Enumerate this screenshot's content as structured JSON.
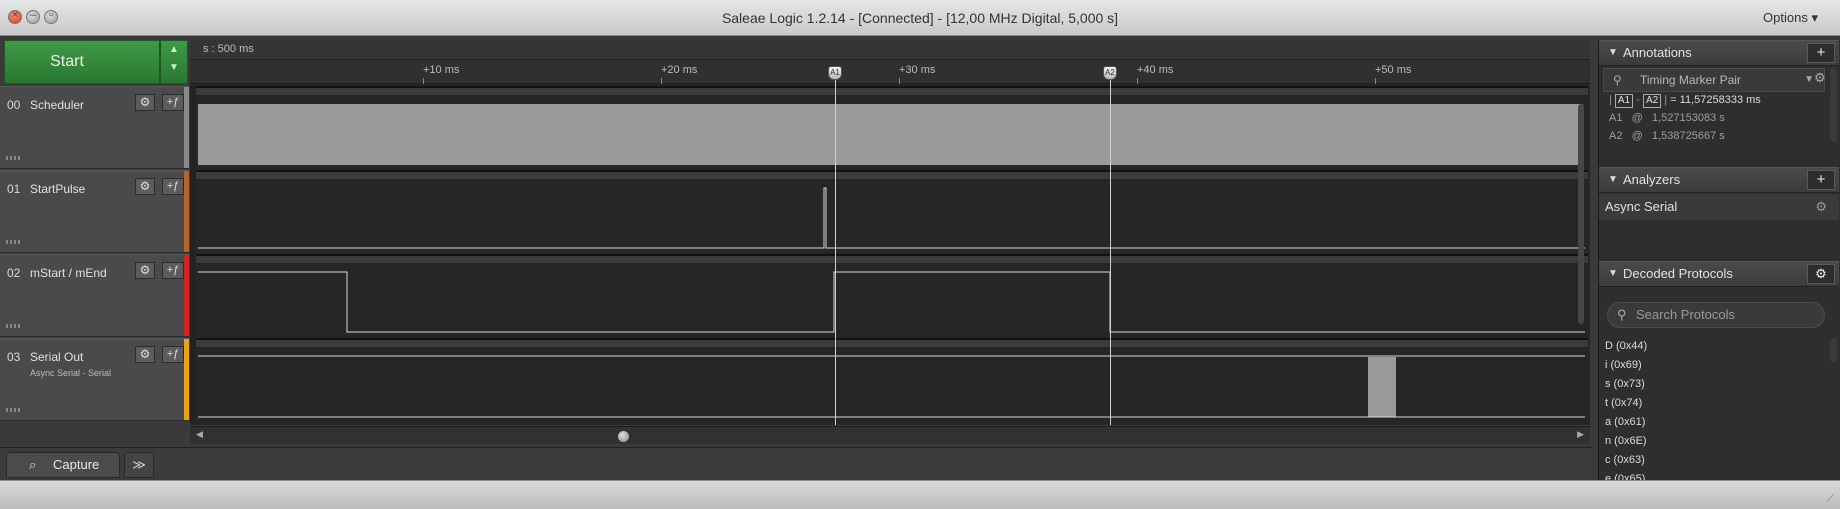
{
  "window": {
    "title": "Saleae Logic 1.2.14 - [Connected] - [12,00 MHz Digital, 5,000 s]",
    "options_label": "Options",
    "options_arrow": "▾"
  },
  "start_button": {
    "label": "Start"
  },
  "channels": [
    {
      "num": "00",
      "name": "Scheduler",
      "sub": "",
      "color": "#8a8a8a"
    },
    {
      "num": "01",
      "name": "StartPulse",
      "sub": "",
      "color": "#b5652b"
    },
    {
      "num": "02",
      "name": "mStart / mEnd",
      "sub": "",
      "color": "#d42323"
    },
    {
      "num": "03",
      "name": "Serial Out",
      "sub": "Async Serial - Serial",
      "color": "#e8a31a"
    }
  ],
  "timeline": {
    "scale_label": "s : 500 ms",
    "ticks": [
      "+10 ms",
      "+20 ms",
      "+30 ms",
      "+40 ms",
      "+50 ms"
    ],
    "markers": [
      "A1",
      "A2"
    ]
  },
  "bottom": {
    "capture_tab": "Capture",
    "more_tab": "≫"
  },
  "annotations": {
    "header": "Annotations",
    "marker_pair": "Timing Marker Pair",
    "delta_label_a": "A1",
    "delta_label_b": "A2",
    "delta_value": "= 11,57258333 ms",
    "a1_label": "A1",
    "a1_at": "@",
    "a1_value": "1,527153083 s",
    "a2_label": "A2",
    "a2_at": "@",
    "a2_value": "1,538725667 s"
  },
  "analyzers": {
    "header": "Analyzers",
    "items": [
      "Async Serial"
    ]
  },
  "decoded": {
    "header": "Decoded Protocols",
    "search_placeholder": "Search Protocols",
    "rows": [
      "D (0x44)",
      "i (0x69)",
      "s (0x73)",
      "t (0x74)",
      "a (0x61)",
      "n (0x6E)",
      "c (0x63)",
      "e (0x65)"
    ]
  }
}
